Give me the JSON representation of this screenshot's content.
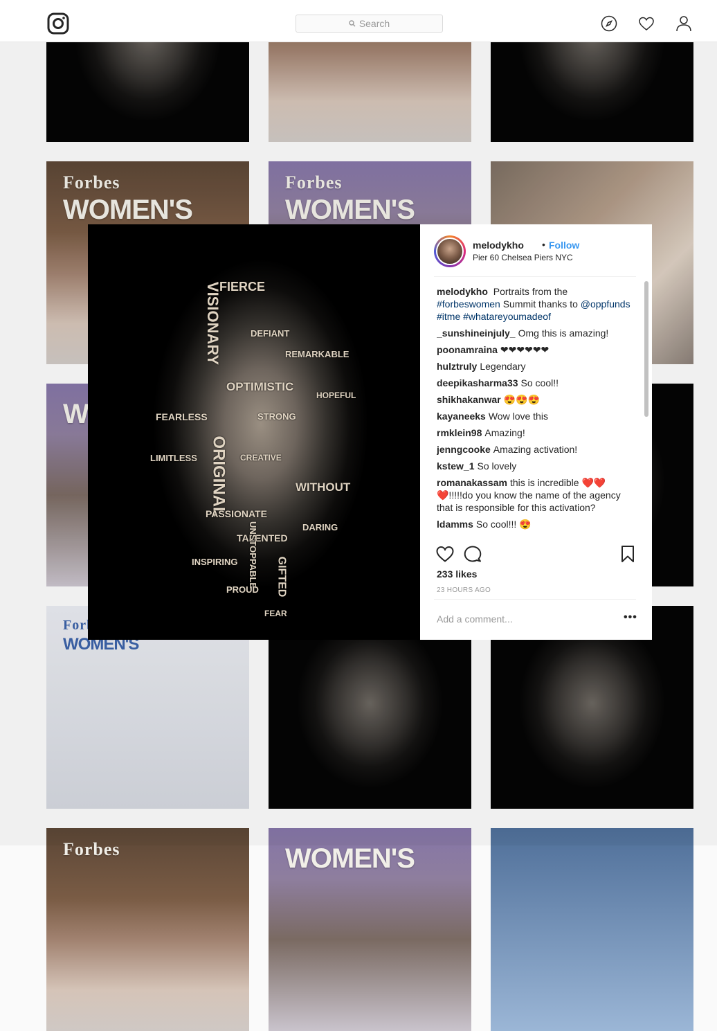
{
  "nav": {
    "search_placeholder": "Search",
    "icons": [
      "instagram-logo-icon",
      "explore-icon",
      "heart-icon",
      "profile-icon"
    ]
  },
  "grid": {
    "tiles": [
      {
        "kind": "dark"
      },
      {
        "kind": "event",
        "brand": "",
        "brand_big": "WOMEN"
      },
      {
        "kind": "dark"
      },
      {
        "kind": "event",
        "brand": "Forbes",
        "brand_big": "WOMEN'S"
      },
      {
        "kind": "stage",
        "brand": "Forbes",
        "brand_big": "WOMEN'S"
      },
      {
        "kind": "selfie"
      },
      {
        "kind": "stage",
        "brand": "",
        "brand_big": "WO"
      },
      {
        "kind": "dark"
      },
      {
        "kind": "dark"
      },
      {
        "kind": "photo",
        "brand": "Forbes",
        "brand_big": "WOMEN'S"
      },
      {
        "kind": "dark"
      },
      {
        "kind": "dark"
      },
      {
        "kind": "event",
        "brand": "Forbes",
        "brand_big": ""
      },
      {
        "kind": "stage",
        "brand": "",
        "brand_big": "WOMEN'S"
      },
      {
        "kind": "blue"
      }
    ]
  },
  "post": {
    "username": "melodykho",
    "separator": "•",
    "follow_label": "Follow",
    "location": "Pier 60 Chelsea Piers NYC",
    "caption": {
      "user": "melodykho",
      "parts": [
        {
          "text": "Portraits from the ",
          "tag": false
        },
        {
          "text": "#forbeswomen",
          "tag": true
        },
        {
          "text": " Summit thanks to ",
          "tag": false
        },
        {
          "text": "@oppfunds",
          "tag": true
        },
        {
          "text": " ",
          "tag": false
        },
        {
          "text": "#itme",
          "tag": true
        },
        {
          "text": " ",
          "tag": false
        },
        {
          "text": "#whatareyoumadeof",
          "tag": true
        }
      ]
    },
    "comments": [
      {
        "user": "_sunshineinjuly_",
        "text": "Omg this is amazing!"
      },
      {
        "user": "poonamraina",
        "text": "❤❤❤❤❤❤"
      },
      {
        "user": "hulztruly",
        "text": "Legendary"
      },
      {
        "user": "deepikasharma33",
        "text": "So cool!!"
      },
      {
        "user": "shikhakanwar",
        "text": "😍😍😍"
      },
      {
        "user": "kayaneeks",
        "text": "Wow love this"
      },
      {
        "user": "rmklein98",
        "text": "Amazing!"
      },
      {
        "user": "jenngcooke",
        "text": "Amazing activation!"
      },
      {
        "user": "kstew_1",
        "text": "So lovely"
      },
      {
        "user": "romanakassam",
        "text": "this is incredible ❤️❤️❤️!!!!!do you know the name of the agency that is responsible for this activation?"
      },
      {
        "user": "ldamms",
        "text": "So cool!!! 😍"
      }
    ],
    "likes": "233 likes",
    "time": "23 HOURS AGO",
    "add_comment_placeholder": "Add a comment...",
    "more_label": "•••",
    "portrait_words": [
      "FIERCE",
      "VISIONARY",
      "OPTIMISTIC",
      "ORIGINAL",
      "WITHOUT",
      "FEARLESS",
      "PASSIONATE",
      "INSPIRING",
      "LIMITLESS",
      "DEFIANT",
      "HOPEFUL",
      "GIFTED",
      "DARING",
      "TALENTED",
      "STRONG",
      "REMARKABLE",
      "CREATIVE",
      "UNSTOPPABLE",
      "FEAR",
      "PROUD"
    ]
  }
}
